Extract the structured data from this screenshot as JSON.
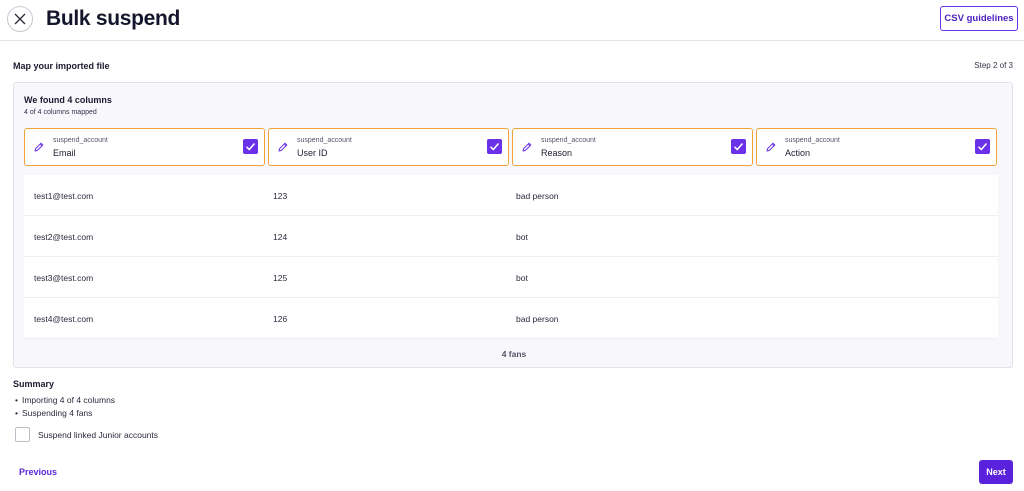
{
  "header": {
    "title": "Bulk suspend",
    "csv_button": "CSV guidelines"
  },
  "mapping": {
    "title": "Map your imported file",
    "step": "Step 2 of 3",
    "found_title": "We found 4 columns",
    "found_sub": "4 of 4 columns mapped",
    "columns": [
      {
        "group": "suspend_account",
        "name": "Email",
        "checked": true
      },
      {
        "group": "suspend_account",
        "name": "User ID",
        "checked": true
      },
      {
        "group": "suspend_account",
        "name": "Reason",
        "checked": true
      },
      {
        "group": "suspend_account",
        "name": "Action",
        "checked": true
      }
    ],
    "rows": [
      [
        "test1@test.com",
        "123",
        "bad person"
      ],
      [
        "test2@test.com",
        "124",
        "bot"
      ],
      [
        "test3@test.com",
        "125",
        "bot"
      ],
      [
        "test4@test.com",
        "126",
        "bad person"
      ]
    ],
    "fans_count": "4 fans"
  },
  "summary": {
    "title": "Summary",
    "items": [
      "Importing 4 of 4 columns",
      "Suspending 4 fans"
    ],
    "linked_label": "Suspend linked Junior accounts"
  },
  "footer": {
    "previous": "Previous",
    "next": "Next"
  },
  "colors": {
    "accent": "#6a31e8",
    "card_border": "#f1a33a"
  },
  "icons": {
    "close": "close-icon",
    "pencil": "pencil-icon",
    "check": "check-icon"
  }
}
